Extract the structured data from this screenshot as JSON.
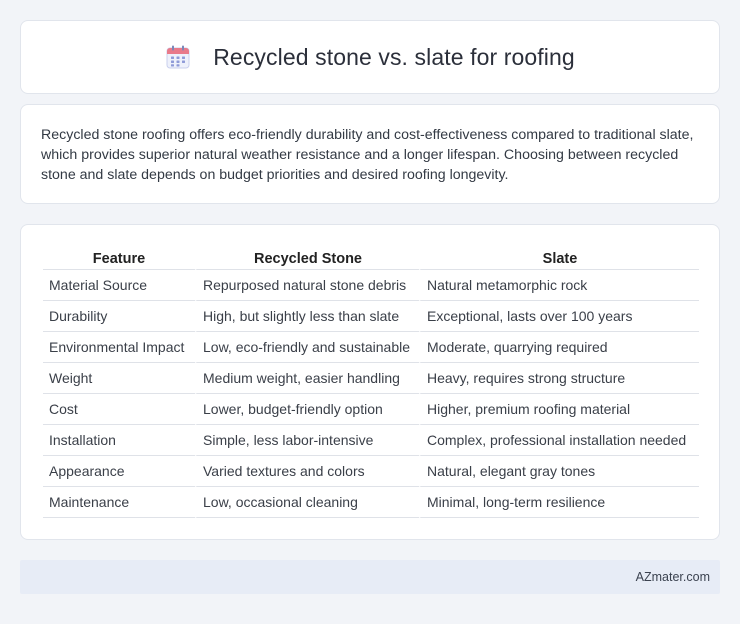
{
  "header": {
    "title": "Recycled stone vs. slate for roofing",
    "icon": "calendar-icon",
    "icon_color": "#6b7fd6"
  },
  "description": "Recycled stone roofing offers eco-friendly durability and cost-effectiveness compared to traditional slate, which provides superior natural weather resistance and a longer lifespan. Choosing between recycled stone and slate depends on budget priorities and desired roofing longevity.",
  "table": {
    "headers": [
      "Feature",
      "Recycled Stone",
      "Slate"
    ],
    "rows": [
      [
        "Material Source",
        "Repurposed natural stone debris",
        "Natural metamorphic rock"
      ],
      [
        "Durability",
        "High, but slightly less than slate",
        "Exceptional, lasts over 100 years"
      ],
      [
        "Environmental Impact",
        "Low, eco-friendly and sustainable",
        "Moderate, quarrying required"
      ],
      [
        "Weight",
        "Medium weight, easier handling",
        "Heavy, requires strong structure"
      ],
      [
        "Cost",
        "Lower, budget-friendly option",
        "Higher, premium roofing material"
      ],
      [
        "Installation",
        "Simple, less labor-intensive",
        "Complex, professional installation needed"
      ],
      [
        "Appearance",
        "Varied textures and colors",
        "Natural, elegant gray tones"
      ],
      [
        "Maintenance",
        "Low, occasional cleaning",
        "Minimal, long-term resilience"
      ]
    ]
  },
  "footer": {
    "text": "AZmater.com"
  }
}
